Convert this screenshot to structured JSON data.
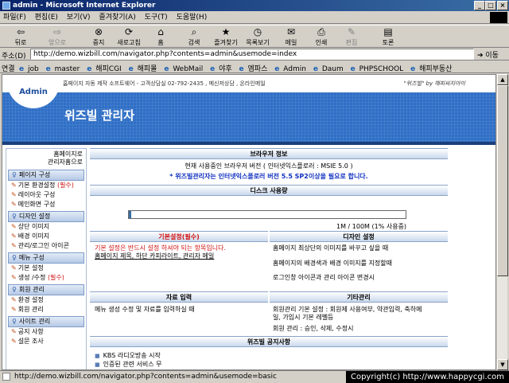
{
  "window": {
    "title": "admin - Microsoft Internet Explorer"
  },
  "menu": [
    "파일(F)",
    "편집(E)",
    "보기(V)",
    "즐겨찾기(A)",
    "도구(T)",
    "도움말(H)"
  ],
  "toolbar": {
    "back": "뒤로",
    "forward": "앞으로",
    "stop": "중지",
    "refresh": "새로고침",
    "home": "홈",
    "search": "검색",
    "favorites": "즐겨찾기",
    "history": "목록보기",
    "mail": "메일",
    "print": "인쇄",
    "edit": "편집",
    "discuss": "토론"
  },
  "address": {
    "label": "주소(D)",
    "url": "http://demo.wizbill.com/navigator.php?contents=admin&usemode=index",
    "go": "이동"
  },
  "links": {
    "label": "연결",
    "items": [
      "job",
      "master",
      "해피CGI",
      "해피몰",
      "WebMail",
      "야후",
      "엠파스",
      "Admin",
      "Daum",
      "PHPSCHOOL",
      "해피부동산"
    ]
  },
  "header": {
    "admin_label": "Admin",
    "info": "홈페이지 자동 제작 소프트웨어 - 고객상담실 02-792-2435 , 메신저상담 , 온라인메일",
    "brand": "\"위즈빌\" by 해피씨지아이",
    "banner_title": "위즈빌 관리자"
  },
  "sidebar": {
    "home_line1": "홈페이지로",
    "home_line2": "관리자홈으로",
    "sections": [
      {
        "title": "페이지 구성",
        "items": [
          {
            "label": "기본 환경설정",
            "badge": "(필수)"
          },
          {
            "label": "레이아웃 구성",
            "badge": ""
          },
          {
            "label": "메인화면 구성",
            "badge": ""
          }
        ]
      },
      {
        "title": "디자인 설정",
        "items": [
          {
            "label": "상단 이미지",
            "badge": ""
          },
          {
            "label": "배경 이미지",
            "badge": ""
          },
          {
            "label": "관리/로그인 아이콘",
            "badge": ""
          }
        ]
      },
      {
        "title": "메뉴 구성",
        "items": [
          {
            "label": "기본 설정",
            "badge": ""
          },
          {
            "label": "생성 /수정",
            "badge": "(필수)"
          }
        ]
      },
      {
        "title": "회원 관리",
        "items": [
          {
            "label": "환경 설정",
            "badge": ""
          },
          {
            "label": "회원 관리",
            "badge": ""
          }
        ]
      },
      {
        "title": "사이트 관리",
        "items": [
          {
            "label": "공지 사항",
            "badge": ""
          },
          {
            "label": "설문 조사",
            "badge": ""
          }
        ]
      }
    ]
  },
  "main": {
    "browser_info_title": "브라우저 정보",
    "browser_version": "현재 사용중인 브라우저 버전 ( 인터넷익스플로러 : MSIE 5.0 )",
    "browser_notice": "* 위즈빌관리자는 인터넷익스플로러 버전 5.5 SP2이상을 필요로 합니다.",
    "disk_title": "디스크 사용량",
    "disk_usage_text": "1M / 100M (1% 사용중)",
    "disk_usage_fraction": 0.01,
    "basic_title": "기본설정(필수)",
    "basic_desc1": "기본 설정은 반드시 설정 하셔야 되는 항목입니다.",
    "basic_desc2": "홈페이지 제목, 하단 카피라이트, 관리자 메일",
    "design_title": "디자인 설정",
    "design_desc1": "홈페이지 최상단의 이미지를 바꾸고 싶을 때",
    "design_desc2": "홈페이지의 배경색과 배경 이미지를 지정할때",
    "design_desc3": "로그인창 아이콘과 관리 아이콘 변경시",
    "data_title": "자료 입력",
    "data_desc": "메뉴 생성 수정 및 자료를 입력하실 때",
    "misc_title": "기타관리",
    "misc_desc1": "회원관리 기본 설정 : 회원제 사용여부, 약관입력, 축하메",
    "misc_desc2": "일, 가입시 기본 레벨등",
    "misc_desc3": "회원 관리 : 승인, 삭제, 수정시",
    "notice_title": "위즈빌 공지사항",
    "notices": [
      "KBS 라디오방송 시작",
      "인증된 관련 서비스 무"
    ]
  },
  "status": {
    "url": "http://demo.wizbill.com/navigator.php?contents=admin&usemode=basic",
    "copyright": "Copyright(c) http://www.happycgi.com"
  }
}
